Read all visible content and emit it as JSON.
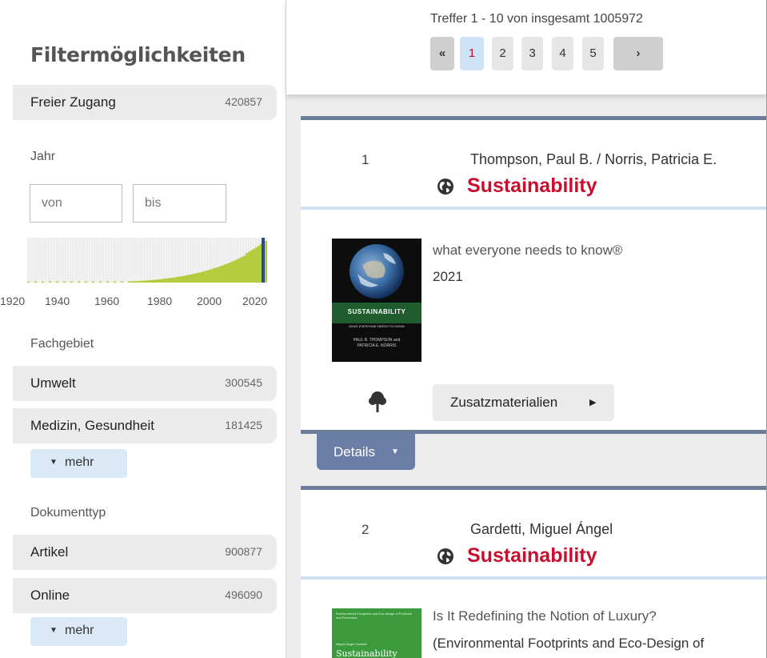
{
  "sidebar": {
    "title": "Filtermöglichkeiten",
    "open_access": {
      "label": "Freier Zugang",
      "count": "420857"
    },
    "year": {
      "label": "Jahr",
      "from_placeholder": "von",
      "to_placeholder": "bis",
      "tick_labels": [
        "1920",
        "1940",
        "1960",
        "1980",
        "2000",
        "2020"
      ]
    },
    "subject": {
      "label": "Fachgebiet",
      "items": [
        {
          "label": "Umwelt",
          "count": "300545"
        },
        {
          "label": "Medizin, Gesundheit",
          "count": "181425"
        }
      ],
      "more": "mehr"
    },
    "doctype": {
      "label": "Dokumenttyp",
      "items": [
        {
          "label": "Artikel",
          "count": "900877"
        },
        {
          "label": "Online",
          "count": "496090"
        }
      ],
      "more": "mehr"
    }
  },
  "results": {
    "summary": "Treffer 1 - 10 von insgesamt 1005972",
    "pagination": {
      "first": "«",
      "pages": [
        "1",
        "2",
        "3",
        "4",
        "5"
      ],
      "current": "1",
      "next": "›"
    },
    "items": [
      {
        "number": "1",
        "authors": "Thompson, Paul B. / Norris, Patricia E.",
        "title": "Sustainability",
        "subtitle": "what everyone needs to know®",
        "year": "2021",
        "cover": {
          "title": "SUSTAINABILITY",
          "subtitle": "WHAT EVERYONE NEEDS TO KNOW",
          "authors_line1": "PAUL B. THOMPSON and",
          "authors_line2": "PATRICIA E. NORRIS"
        },
        "supplement_button": "Zusatzmaterialien",
        "details_button": "Details"
      },
      {
        "number": "2",
        "authors": "Gardetti, Miguel Ángel",
        "title": "Sustainability",
        "subtitle": "Is It Redefining the Notion of Luxury?",
        "series": "(Environmental Footprints and Eco-Design of",
        "cover": {
          "series": "Environmental Footprints and Eco-design of Products and Processes",
          "author": "Miguel Ángel Gardetti",
          "title": "Sustainability"
        }
      }
    ]
  },
  "colors": {
    "accent": "#c8102e",
    "card_border": "#6b7c99",
    "chip": "#ebebeb",
    "more_bg": "#dbe9f7"
  }
}
